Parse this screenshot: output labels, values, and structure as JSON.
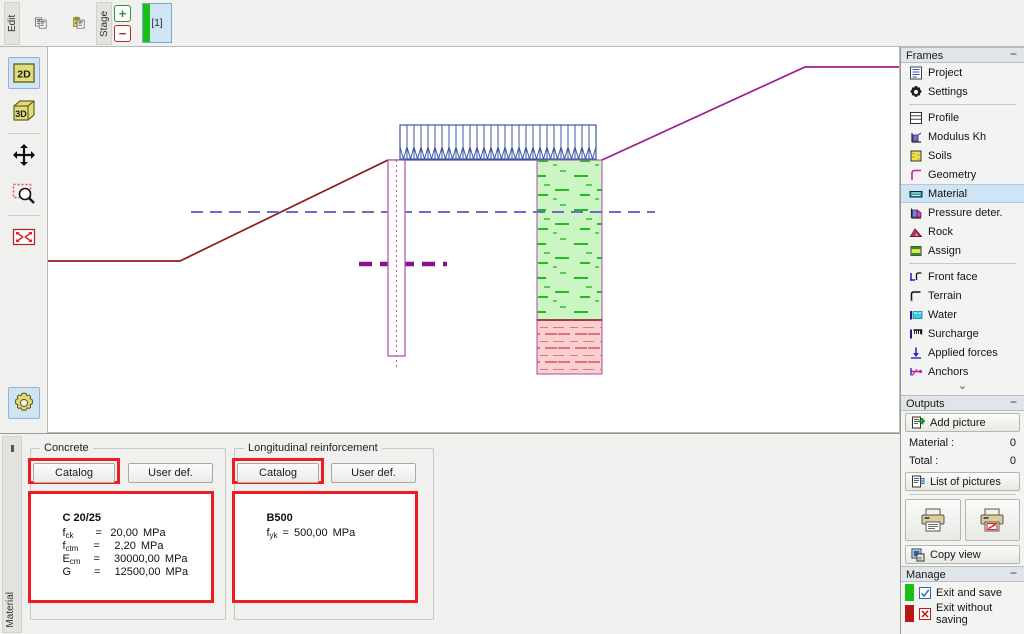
{
  "topbar": {
    "edit_tab": "Edit",
    "stage_tab": "Stage",
    "copy_icon": "copy-icon",
    "paste_icon": "paste-icon",
    "add_stage_label": "+",
    "remove_stage_label": "−",
    "stage_chip_label": "[1]"
  },
  "lefttool": {
    "view2d": "2D",
    "view3d": "3D",
    "pan_icon": "pan-move-icon",
    "zoom_icon": "zoom-window-icon",
    "fit_icon": "zoom-fit-icon",
    "settings_icon": "gear-icon"
  },
  "bottom": {
    "vertical_tab": "Material",
    "concrete": {
      "title": "Concrete",
      "catalog_button": "Catalog",
      "userdef_button": "User def.",
      "grade": "C 20/25",
      "rows": [
        {
          "sym": "f",
          "sub": "ck",
          "eq": "=",
          "value": "20,00",
          "unit": "MPa"
        },
        {
          "sym": "f",
          "sub": "ctm",
          "eq": "=",
          "value": "2,20",
          "unit": "MPa"
        },
        {
          "sym": "E",
          "sub": "cm",
          "eq": "=",
          "value": "30000,00",
          "unit": "MPa"
        },
        {
          "sym": "G",
          "sub": "",
          "eq": "=",
          "value": "12500,00",
          "unit": "MPa"
        }
      ]
    },
    "reinforcement": {
      "title": "Longitudinal reinforcement",
      "catalog_button": "Catalog",
      "userdef_button": "User def.",
      "grade": "B500",
      "rows": [
        {
          "sym": "f",
          "sub": "yk",
          "eq": "=",
          "value": "500,00",
          "unit": "MPa"
        }
      ]
    }
  },
  "sidebar": {
    "frames": {
      "header": "Frames",
      "collapse": "−",
      "items": [
        {
          "label": "Project",
          "icon": "project-icon",
          "selected": false
        },
        {
          "label": "Settings",
          "icon": "gear-icon",
          "selected": false
        },
        {
          "divider": true
        },
        {
          "label": "Profile",
          "icon": "profile-icon",
          "selected": false
        },
        {
          "label": "Modulus Kh",
          "icon": "modulus-icon",
          "selected": false
        },
        {
          "label": "Soils",
          "icon": "soils-icon",
          "selected": false
        },
        {
          "label": "Geometry",
          "icon": "geometry-icon",
          "selected": false
        },
        {
          "label": "Material",
          "icon": "material-icon",
          "selected": true
        },
        {
          "label": "Pressure deter.",
          "icon": "pressure-icon",
          "selected": false
        },
        {
          "label": "Rock",
          "icon": "rock-icon",
          "selected": false
        },
        {
          "label": "Assign",
          "icon": "assign-icon",
          "selected": false
        },
        {
          "divider": true
        },
        {
          "label": "Front face",
          "icon": "front-face-icon",
          "selected": false
        },
        {
          "label": "Terrain",
          "icon": "terrain-icon",
          "selected": false
        },
        {
          "label": "Water",
          "icon": "water-icon",
          "selected": false
        },
        {
          "label": "Surcharge",
          "icon": "surcharge-icon",
          "selected": false
        },
        {
          "label": "Applied forces",
          "icon": "applied-forces-icon",
          "selected": false
        },
        {
          "label": "Anchors",
          "icon": "anchors-icon",
          "selected": false
        }
      ],
      "more_chevron": "⌄"
    },
    "outputs": {
      "header": "Outputs",
      "collapse": "−",
      "add_picture": "Add picture",
      "material_key": "Material :",
      "material_value": "0",
      "total_key": "Total :",
      "total_value": "0",
      "list_of_pictures": "List of pictures",
      "print_icon": "printer-icon",
      "print_preview_icon": "printer-preview-icon",
      "copy_view": "Copy view"
    },
    "manage": {
      "header": "Manage",
      "collapse": "−",
      "exit_save": "Exit and save",
      "exit_nosave": "Exit without saving",
      "exit_save_color": "#18c018",
      "exit_nosave_color": "#b51717"
    }
  },
  "drawing": {
    "left_terrain_color": "#8b1a1a",
    "right_terrain_color": "#9b1f8f",
    "water_table_color": "#6b6bd0",
    "wall_color": "#b05ab0",
    "surcharge_color": "#3a56a8",
    "anchor_color": "#8b0f8b",
    "soil_upper_fill": "#ccf5c4",
    "soil_upper_stroke": "#22bb22",
    "soil_lower_fill": "#fbcfcf",
    "soil_lower_stroke": "#d04040"
  }
}
